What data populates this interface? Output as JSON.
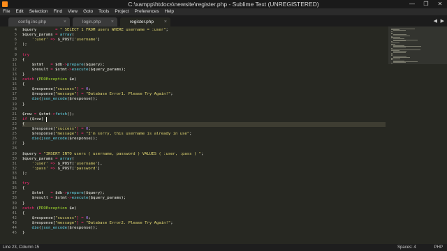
{
  "window": {
    "title": "C:\\xampp\\htdocs\\newsite\\register.php - Sublime Text (UNREGISTERED)",
    "controls": [
      "—",
      "❐",
      "✕"
    ]
  },
  "menu": [
    "File",
    "Edit",
    "Selection",
    "Find",
    "View",
    "Goto",
    "Tools",
    "Project",
    "Preferences",
    "Help"
  ],
  "tabs": [
    {
      "label": "config.inc.php",
      "close": "×"
    },
    {
      "label": "login.php",
      "close": "×"
    },
    {
      "label": "register.php",
      "close": "×",
      "active": true
    }
  ],
  "editor": {
    "first_line": 4,
    "current_line": 23,
    "lines": [
      [
        [
          "$query",
          "var"
        ],
        [
          "        = ",
          "op"
        ],
        [
          "\" SELECT 1 FROM users WHERE username = :user\"",
          "str"
        ],
        [
          ";",
          "p"
        ]
      ],
      [
        [
          "$query_params",
          "var"
        ],
        [
          " = ",
          "op"
        ],
        [
          "array",
          "fn"
        ],
        [
          "(",
          "p"
        ]
      ],
      [
        [
          "    ",
          "p"
        ],
        [
          "':user'",
          "str"
        ],
        [
          " => ",
          "op"
        ],
        [
          "$_POST",
          "var"
        ],
        [
          "[",
          "p"
        ],
        [
          "'username'",
          "str"
        ],
        [
          "]",
          "p"
        ]
      ],
      [
        [
          ");",
          "p"
        ]
      ],
      [
        [
          "",
          "p"
        ]
      ],
      [
        [
          "try",
          "kw"
        ]
      ],
      [
        [
          "{",
          "p"
        ]
      ],
      [
        [
          "    ",
          "p"
        ],
        [
          "$stmt",
          "var"
        ],
        [
          "   = ",
          "op"
        ],
        [
          "$db",
          "var"
        ],
        [
          "->",
          "op"
        ],
        [
          "prepare",
          "fn"
        ],
        [
          "($query);",
          "p"
        ]
      ],
      [
        [
          "    ",
          "p"
        ],
        [
          "$result",
          "var"
        ],
        [
          " = ",
          "op"
        ],
        [
          "$stmt",
          "var"
        ],
        [
          "->",
          "op"
        ],
        [
          "execute",
          "fn"
        ],
        [
          "($query_params);",
          "p"
        ]
      ],
      [
        [
          "}",
          "p"
        ]
      ],
      [
        [
          "catch",
          "kw"
        ],
        [
          " (",
          "p"
        ],
        [
          "PDOException",
          "cls"
        ],
        [
          " $e)",
          "p"
        ]
      ],
      [
        [
          "{",
          "p"
        ]
      ],
      [
        [
          "    ",
          "p"
        ],
        [
          "$response",
          "var"
        ],
        [
          "[",
          "p"
        ],
        [
          "\"success\"",
          "str"
        ],
        [
          "] = ",
          "op"
        ],
        [
          "0",
          "num"
        ],
        [
          ";",
          "p"
        ]
      ],
      [
        [
          "    ",
          "p"
        ],
        [
          "$response",
          "var"
        ],
        [
          "[",
          "p"
        ],
        [
          "\"message\"",
          "str"
        ],
        [
          "] = ",
          "op"
        ],
        [
          "\"Database Error1. Please Try Again!\"",
          "str"
        ],
        [
          ";",
          "p"
        ]
      ],
      [
        [
          "    ",
          "p"
        ],
        [
          "die",
          "fn"
        ],
        [
          "(",
          "p"
        ],
        [
          "json_encode",
          "fn"
        ],
        [
          "($response));",
          "p"
        ]
      ],
      [
        [
          "}",
          "p"
        ]
      ],
      [
        [
          "",
          "p"
        ]
      ],
      [
        [
          "$row",
          "var"
        ],
        [
          " = ",
          "op"
        ],
        [
          "$stmt",
          "var"
        ],
        [
          "->",
          "op"
        ],
        [
          "fetch",
          "fn"
        ],
        [
          "();",
          "p"
        ]
      ],
      [
        [
          "if",
          "kw"
        ],
        [
          " (",
          "p"
        ],
        [
          "$row",
          "var"
        ],
        [
          ") ",
          "p"
        ],
        [
          "|",
          "caret"
        ]
      ],
      [
        [
          "{",
          "p"
        ]
      ],
      [
        [
          "    ",
          "p"
        ],
        [
          "$response",
          "var"
        ],
        [
          "[",
          "p"
        ],
        [
          "\"success\"",
          "str"
        ],
        [
          "] = ",
          "op"
        ],
        [
          "0",
          "num"
        ],
        [
          ";",
          "p"
        ]
      ],
      [
        [
          "    ",
          "p"
        ],
        [
          "$response",
          "var"
        ],
        [
          "[",
          "p"
        ],
        [
          "\"message\"",
          "str"
        ],
        [
          "] = ",
          "op"
        ],
        [
          "\"I'm sorry, this username is already in use\"",
          "str"
        ],
        [
          ";",
          "p"
        ]
      ],
      [
        [
          "    ",
          "p"
        ],
        [
          "die",
          "fn"
        ],
        [
          "(",
          "p"
        ],
        [
          "json_encode",
          "fn"
        ],
        [
          "($response));",
          "p"
        ]
      ],
      [
        [
          "}",
          "p"
        ]
      ],
      [
        [
          "",
          "p"
        ]
      ],
      [
        [
          "$query",
          "var"
        ],
        [
          " = ",
          "op"
        ],
        [
          "\"INSERT INTO users ( username, password ) VALUES ( :user, :pass ) \"",
          "str"
        ],
        [
          ";",
          "p"
        ]
      ],
      [
        [
          "$query_params",
          "var"
        ],
        [
          " = ",
          "op"
        ],
        [
          "array",
          "fn"
        ],
        [
          "(",
          "p"
        ]
      ],
      [
        [
          "    ",
          "p"
        ],
        [
          "':user'",
          "str"
        ],
        [
          " => ",
          "op"
        ],
        [
          "$_POST",
          "var"
        ],
        [
          "[",
          "p"
        ],
        [
          "'username'",
          "str"
        ],
        [
          "],",
          "p"
        ]
      ],
      [
        [
          "    ",
          "p"
        ],
        [
          "':pass'",
          "str"
        ],
        [
          " => ",
          "op"
        ],
        [
          "$_POST",
          "var"
        ],
        [
          "[",
          "p"
        ],
        [
          "'password'",
          "str"
        ],
        [
          "]",
          "p"
        ]
      ],
      [
        [
          ");",
          "p"
        ]
      ],
      [
        [
          "",
          "p"
        ]
      ],
      [
        [
          "try",
          "kw"
        ]
      ],
      [
        [
          "{",
          "p"
        ]
      ],
      [
        [
          "    ",
          "p"
        ],
        [
          "$stmt",
          "var"
        ],
        [
          "   = ",
          "op"
        ],
        [
          "$db",
          "var"
        ],
        [
          "->",
          "op"
        ],
        [
          "prepare",
          "fn"
        ],
        [
          "($query);",
          "p"
        ]
      ],
      [
        [
          "    ",
          "p"
        ],
        [
          "$result",
          "var"
        ],
        [
          " = ",
          "op"
        ],
        [
          "$stmt",
          "var"
        ],
        [
          "->",
          "op"
        ],
        [
          "execute",
          "fn"
        ],
        [
          "($query_params);",
          "p"
        ]
      ],
      [
        [
          "}",
          "p"
        ]
      ],
      [
        [
          "catch",
          "kw"
        ],
        [
          " (",
          "p"
        ],
        [
          "PDOException",
          "cls"
        ],
        [
          " $e)",
          "p"
        ]
      ],
      [
        [
          "{",
          "p"
        ]
      ],
      [
        [
          "    ",
          "p"
        ],
        [
          "$response",
          "var"
        ],
        [
          "[",
          "p"
        ],
        [
          "\"success\"",
          "str"
        ],
        [
          "] = ",
          "op"
        ],
        [
          "0",
          "num"
        ],
        [
          ";",
          "p"
        ]
      ],
      [
        [
          "    ",
          "p"
        ],
        [
          "$response",
          "var"
        ],
        [
          "[",
          "p"
        ],
        [
          "\"message\"",
          "str"
        ],
        [
          "] = ",
          "op"
        ],
        [
          "\"Database Error2. Please Try Again!\"",
          "str"
        ],
        [
          ";",
          "p"
        ]
      ],
      [
        [
          "    ",
          "p"
        ],
        [
          "die",
          "fn"
        ],
        [
          "(",
          "p"
        ],
        [
          "json_encode",
          "fn"
        ],
        [
          "($response));",
          "p"
        ]
      ],
      [
        [
          "}",
          "p"
        ]
      ]
    ]
  },
  "status": {
    "position": "Line 23, Column 15",
    "indent": "Spaces: 4",
    "syntax": "PHP"
  },
  "colors": {
    "background": "#272822",
    "keyword": "#f92672",
    "string": "#e6db74",
    "function": "#66d9ef",
    "class": "#a6e22e",
    "number": "#ae81ff"
  }
}
